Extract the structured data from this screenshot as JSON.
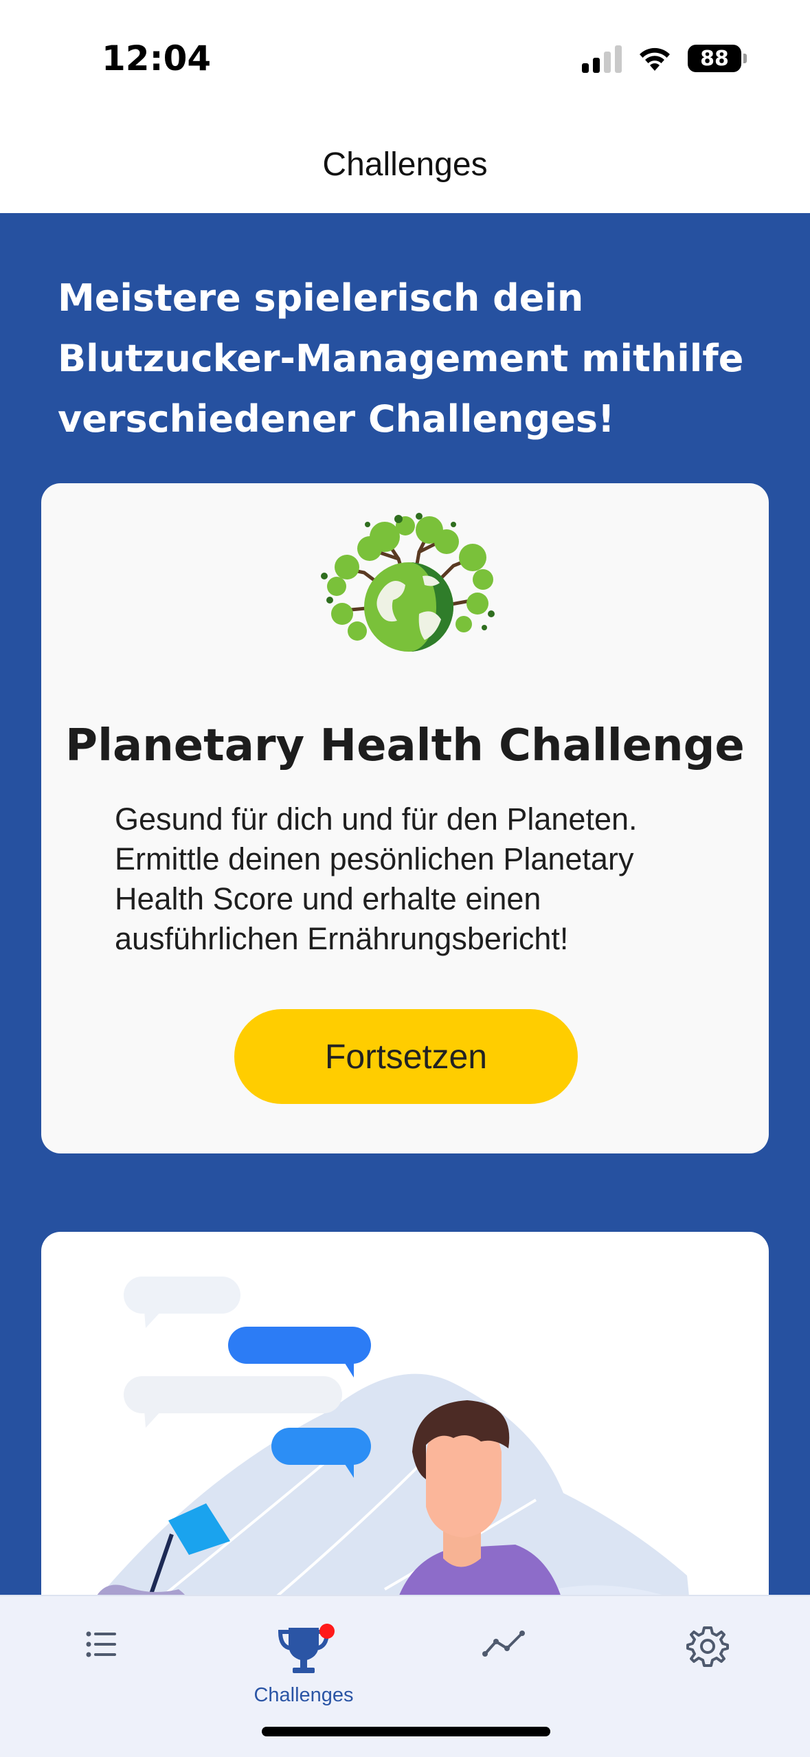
{
  "status_bar": {
    "time": "12:04",
    "battery_level": "88",
    "signal_bars_active": 2,
    "signal_bars_total": 4
  },
  "header": {
    "title": "Challenges"
  },
  "hero": {
    "text": "Meistere spielerisch dein Blutzucker-Management mithilfe verschiedener Challenges!"
  },
  "cards": [
    {
      "icon": "earth-trees-illustration",
      "title": "Planetary Health Challenge",
      "description": "Gesund für dich und für den Planeten. Ermittle deinen pesönlichen Planetary Health Score und erhalte einen ausführlichen Ernährungsbericht!",
      "button_label": "Fortsetzen",
      "button_color": "#ffcd00"
    },
    {
      "icon": "chat-person-illustration"
    }
  ],
  "tab_bar": {
    "items": [
      {
        "icon": "list-icon",
        "label": ""
      },
      {
        "icon": "trophy-icon",
        "label": "Challenges",
        "active": true,
        "badge": true
      },
      {
        "icon": "trend-icon",
        "label": ""
      },
      {
        "icon": "gear-icon",
        "label": ""
      }
    ]
  },
  "colors": {
    "primary_blue": "#2651a0",
    "accent_yellow": "#ffcd00",
    "tab_active": "#2b55a5",
    "badge_red": "#ff1a1a"
  }
}
